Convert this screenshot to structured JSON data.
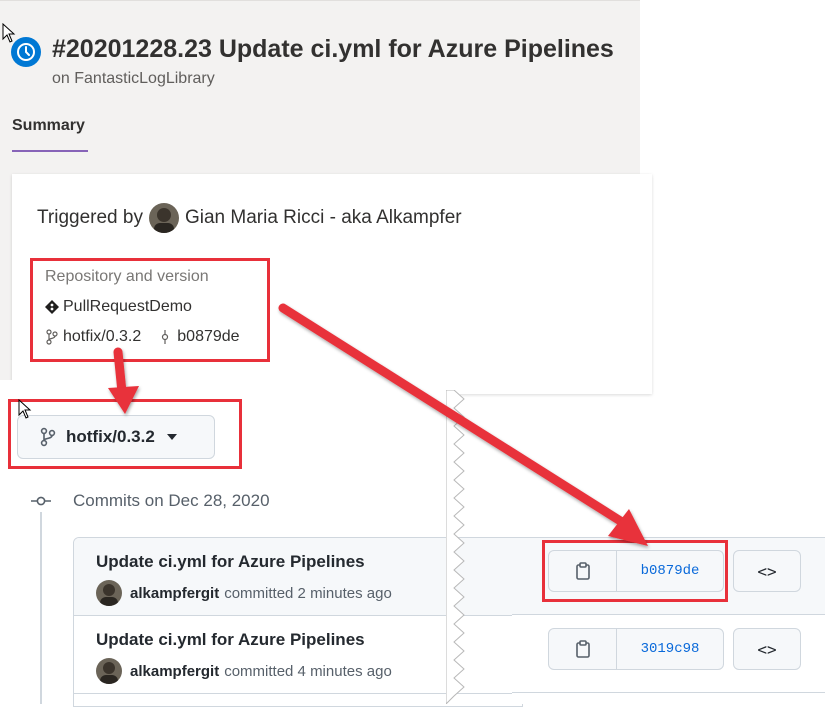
{
  "ado": {
    "run_title": "#20201228.23 Update ci.yml for Azure Pipelines",
    "run_subtitle": "on FantasticLogLibrary",
    "tab_summary": "Summary",
    "triggered_by_label": "Triggered by",
    "triggered_by_user": "Gian Maria Ricci - aka Alkampfer",
    "repo_section_label": "Repository and version",
    "repo_name": "PullRequestDemo",
    "branch": "hotfix/0.3.2",
    "commit": "b0879de"
  },
  "github": {
    "branch_button": "hotfix/0.3.2",
    "commits_header": "Commits on Dec 28, 2020",
    "commits": [
      {
        "message": "Update ci.yml for Azure Pipelines",
        "author": "alkampfergit",
        "meta": "committed 2 minutes ago",
        "sha": "b0879de"
      },
      {
        "message": "Update ci.yml for Azure Pipelines",
        "author": "alkampfergit",
        "meta": "committed 4 minutes ago",
        "sha": "3019c98"
      }
    ],
    "browse_code_label": "<>"
  },
  "colors": {
    "highlight": "#e8303a",
    "ado_accent": "#0078d4",
    "tab_underline": "#8764b8",
    "gh_link": "#0969da"
  },
  "icons": {
    "status": "in-progress-clock-icon",
    "repo": "git-diamond-icon",
    "branch": "git-branch-icon",
    "commit": "git-commit-icon",
    "copy": "clipboard-icon",
    "caret": "caret-down-icon"
  }
}
